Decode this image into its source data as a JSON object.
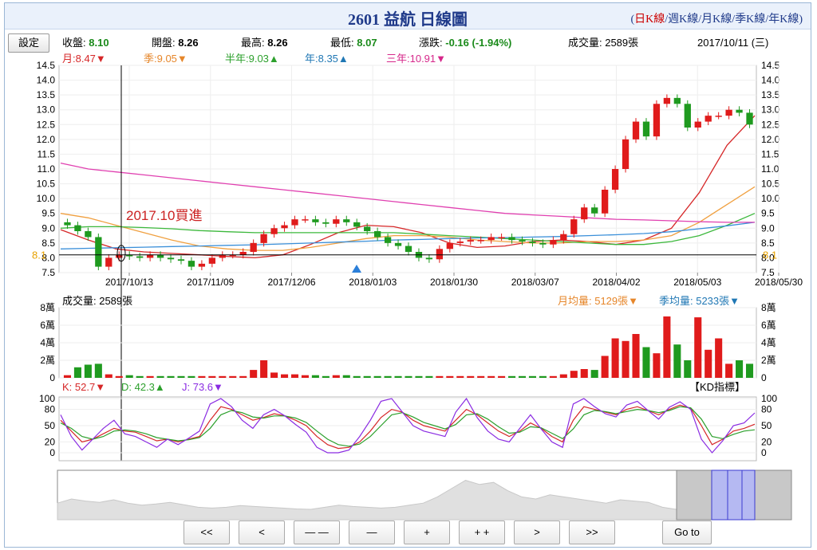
{
  "header": {
    "title": "2601 益航  日線圖",
    "tabs": [
      "日K線",
      "週K線",
      "月K線",
      "季K線",
      "年K線"
    ],
    "settings_label": "設定"
  },
  "quote": {
    "close_label": "收盤:",
    "close": "8.10",
    "open_label": "開盤:",
    "open": "8.26",
    "high_label": "最高:",
    "high": "8.26",
    "low_label": "最低:",
    "low": "8.07",
    "change_label": "漲跌:",
    "change": "-0.16 (-1.94%)",
    "volume_text": "成交量: 2589張",
    "date": "2017/10/11 (三)"
  },
  "ma_legend": [
    {
      "label": "月:8.47",
      "arrow": "▼",
      "color": "#d62728",
      "arrow_color": "#d62728"
    },
    {
      "label": "季:9.05",
      "arrow": "▼",
      "color": "#e6862a",
      "arrow_color": "#e6862a"
    },
    {
      "label": "半年:9.03",
      "arrow": "▲",
      "color": "#2ca02c",
      "arrow_color": "#2ca02c"
    },
    {
      "label": "年:8.35",
      "arrow": "▲",
      "color": "#1f77b4",
      "arrow_color": "#1f77b4"
    },
    {
      "label": "三年:10.91",
      "arrow": "▼",
      "color": "#d6278a",
      "arrow_color": "#d6278a"
    }
  ],
  "volume_panel": {
    "label": "成交量: 2589張",
    "month_avg": "月均量: 5129張",
    "month_arrow": "▼",
    "quarter_avg": "季均量: 5233張",
    "quarter_arrow": "▼"
  },
  "kd_panel": {
    "k": "K: 52.7",
    "k_arrow": "▼",
    "d": "D: 42.3",
    "d_arrow": "▲",
    "j": "J: 73.6",
    "j_arrow": "▼",
    "title": "【KD指標】"
  },
  "annotation": "2017.10買進",
  "cursor_price": "8.1",
  "nav_buttons": [
    "<<",
    "<",
    "— —",
    "—",
    "+",
    "+ +",
    ">",
    ">>"
  ],
  "goto_label": "Go to",
  "colors": {
    "up": "#e01b1b",
    "down": "#1f9a1f",
    "ma_month": "#d62728",
    "ma_quarter": "#f0a040",
    "ma_half": "#3cb83c",
    "ma_year": "#3a8fd9",
    "ma_3y": "#e040b0"
  },
  "chart_data": [
    {
      "type": "candlestick",
      "title": "2601 益航  日線圖",
      "x_ticks": [
        "2017/10/13",
        "2017/11/09",
        "2017/12/06",
        "2018/01/03",
        "2018/01/30",
        "2018/03/07",
        "2018/04/02",
        "2018/05/03",
        "2018/05/30"
      ],
      "y_ticks": [
        7.5,
        8.0,
        8.5,
        9.0,
        9.5,
        10.0,
        10.5,
        11.0,
        11.5,
        12.0,
        12.5,
        13.0,
        13.5,
        14.0,
        14.5
      ],
      "ylim": [
        7.5,
        14.5
      ],
      "series": [
        {
          "name": "月",
          "values": [
            8.95,
            8.6,
            8.3,
            8.2,
            8.15,
            8.1,
            8.05,
            8.0,
            8.1,
            8.45,
            8.85,
            9.1,
            9.05,
            8.85,
            8.5,
            8.35,
            8.4,
            8.55,
            8.6,
            8.55,
            8.45,
            8.6,
            9.0,
            10.2,
            11.8,
            12.8
          ]
        },
        {
          "name": "季",
          "values": [
            9.5,
            9.35,
            9.1,
            8.85,
            8.6,
            8.4,
            8.3,
            8.25,
            8.25,
            8.35,
            8.5,
            8.65,
            8.75,
            8.75,
            8.7,
            8.6,
            8.55,
            8.5,
            8.5,
            8.55,
            8.55,
            8.6,
            8.75,
            9.2,
            9.8,
            10.4
          ]
        },
        {
          "name": "半年",
          "values": [
            9.0,
            9.05,
            9.05,
            9.02,
            8.98,
            8.92,
            8.88,
            8.85,
            8.85,
            8.85,
            8.85,
            8.85,
            8.85,
            8.8,
            8.75,
            8.7,
            8.65,
            8.6,
            8.55,
            8.5,
            8.45,
            8.45,
            8.55,
            8.75,
            9.1,
            9.5
          ]
        },
        {
          "name": "年",
          "values": [
            8.3,
            8.32,
            8.34,
            8.36,
            8.38,
            8.4,
            8.42,
            8.44,
            8.47,
            8.5,
            8.53,
            8.56,
            8.6,
            8.62,
            8.65,
            8.67,
            8.68,
            8.7,
            8.72,
            8.75,
            8.78,
            8.82,
            8.88,
            8.98,
            9.08,
            9.2
          ]
        },
        {
          "name": "三年",
          "values": [
            11.2,
            11.0,
            10.9,
            10.8,
            10.7,
            10.6,
            10.5,
            10.4,
            10.3,
            10.2,
            10.1,
            10.0,
            9.9,
            9.8,
            9.7,
            9.6,
            9.5,
            9.45,
            9.4,
            9.35,
            9.3,
            9.28,
            9.25,
            9.22,
            9.2,
            9.2
          ]
        }
      ],
      "close_values": [
        9.1,
        8.9,
        8.7,
        7.7,
        8.0,
        8.1,
        8.05,
        8.0,
        8.1,
        8.0,
        7.95,
        7.9,
        7.7,
        7.8,
        8.0,
        8.1,
        8.1,
        8.2,
        8.5,
        8.8,
        9.0,
        9.1,
        9.3,
        9.3,
        9.2,
        9.15,
        9.3,
        9.2,
        9.05,
        8.9,
        8.7,
        8.5,
        8.4,
        8.2,
        8.0,
        7.95,
        8.3,
        8.5,
        8.55,
        8.6,
        8.6,
        8.7,
        8.7,
        8.6,
        8.55,
        8.5,
        8.45,
        8.6,
        8.8,
        9.3,
        9.7,
        9.5,
        10.3,
        11.0,
        12.0,
        12.6,
        12.1,
        13.2,
        13.4,
        13.2,
        12.4,
        12.6,
        12.8,
        12.8,
        13.0,
        12.9,
        12.5
      ],
      "cursor_price": 8.1
    },
    {
      "type": "bar",
      "title": "成交量",
      "y_ticks": [
        "0",
        "2萬",
        "4萬",
        "6萬",
        "8萬"
      ],
      "ylim": [
        0,
        8
      ],
      "values": [
        0.3,
        1.2,
        1.5,
        1.6,
        0.4,
        0.2,
        0.3,
        0.2,
        0.2,
        0.2,
        0.2,
        0.2,
        0.2,
        0.2,
        0.2,
        0.2,
        0.2,
        0.2,
        0.9,
        2.0,
        0.6,
        0.4,
        0.4,
        0.3,
        0.3,
        0.2,
        0.3,
        0.3,
        0.2,
        0.2,
        0.2,
        0.2,
        0.2,
        0.2,
        0.2,
        0.2,
        0.2,
        0.2,
        0.2,
        0.2,
        0.2,
        0.2,
        0.2,
        0.2,
        0.2,
        0.2,
        0.2,
        0.2,
        0.4,
        0.8,
        1.0,
        0.9,
        2.5,
        4.5,
        4.2,
        5.0,
        3.5,
        2.8,
        7.0,
        3.8,
        2.0,
        6.9,
        3.2,
        4.5,
        1.6,
        2.0,
        1.6
      ]
    },
    {
      "type": "line",
      "title": "KD指標",
      "y_ticks": [
        0,
        20,
        50,
        80,
        100
      ],
      "ylim": [
        0,
        100
      ],
      "series": [
        {
          "name": "K",
          "values": [
            60,
            40,
            20,
            25,
            35,
            45,
            40,
            38,
            30,
            22,
            25,
            20,
            25,
            30,
            60,
            85,
            80,
            70,
            60,
            65,
            72,
            68,
            60,
            50,
            30,
            15,
            8,
            10,
            20,
            40,
            65,
            80,
            75,
            60,
            50,
            45,
            40,
            60,
            80,
            70,
            55,
            40,
            30,
            40,
            55,
            45,
            30,
            20,
            60,
            85,
            80,
            75,
            70,
            80,
            85,
            78,
            70,
            80,
            88,
            82,
            50,
            15,
            25,
            40,
            45,
            52.7
          ]
        },
        {
          "name": "D",
          "values": [
            55,
            45,
            30,
            25,
            30,
            40,
            42,
            40,
            35,
            28,
            25,
            22,
            24,
            28,
            45,
            70,
            78,
            74,
            66,
            64,
            68,
            68,
            64,
            56,
            40,
            25,
            15,
            12,
            16,
            30,
            50,
            70,
            74,
            66,
            56,
            50,
            44,
            52,
            70,
            72,
            62,
            48,
            36,
            38,
            48,
            46,
            36,
            26,
            44,
            70,
            78,
            76,
            72,
            76,
            80,
            78,
            74,
            78,
            85,
            83,
            62,
            30,
            26,
            34,
            40,
            42.3
          ]
        },
        {
          "name": "J",
          "values": [
            70,
            30,
            5,
            25,
            45,
            60,
            35,
            30,
            20,
            10,
            25,
            15,
            27,
            40,
            90,
            100,
            85,
            60,
            45,
            70,
            80,
            68,
            52,
            38,
            10,
            0,
            0,
            5,
            30,
            60,
            95,
            100,
            75,
            50,
            40,
            35,
            30,
            75,
            100,
            65,
            40,
            25,
            20,
            45,
            70,
            44,
            20,
            10,
            90,
            100,
            85,
            72,
            66,
            88,
            95,
            78,
            62,
            84,
            94,
            80,
            25,
            0,
            22,
            50,
            55,
            73.6
          ]
        }
      ]
    }
  ]
}
